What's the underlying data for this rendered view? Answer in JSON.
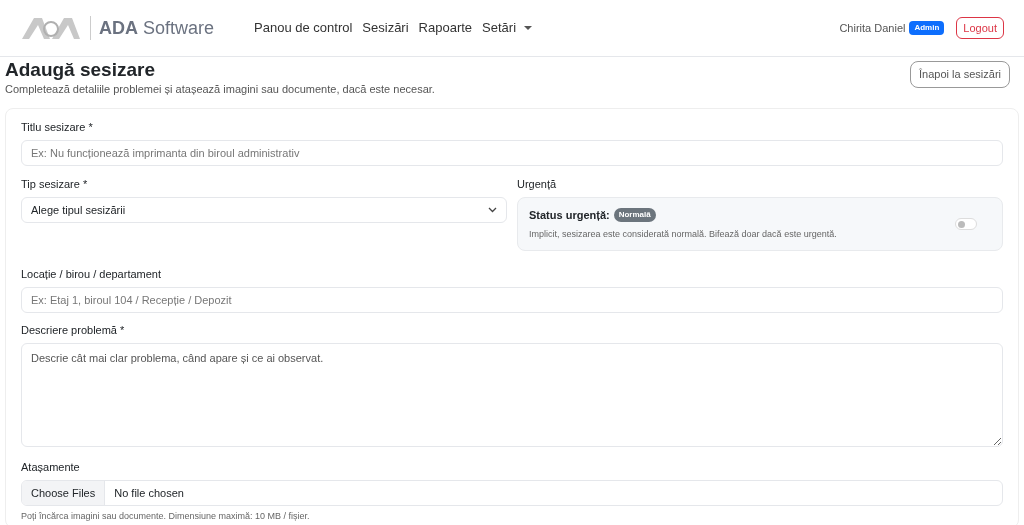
{
  "brand": {
    "name": "ADA",
    "suffix": "Software"
  },
  "nav": [
    {
      "label": "Panou de control",
      "dropdown": false
    },
    {
      "label": "Sesizări",
      "dropdown": false
    },
    {
      "label": "Rapoarte",
      "dropdown": false
    },
    {
      "label": "Setări",
      "dropdown": true
    }
  ],
  "user": {
    "name": "Chirita Daniel",
    "role": "Admin"
  },
  "logout": "Logout",
  "page": {
    "title": "Adaugă sesizare",
    "subtitle": "Completează detaliile problemei și atașează imagini sau documente, dacă este necesar.",
    "back": "Înapoi la sesizări"
  },
  "form": {
    "title_field": {
      "label": "Titlu sesizare *",
      "placeholder": "Ex: Nu funcționează imprimanta din biroul administrativ"
    },
    "type_field": {
      "label": "Tip sesizare *",
      "value": "Alege tipul sesizării"
    },
    "urgency": {
      "label": "Urgență",
      "status_label": "Status urgență:",
      "badge": "Normală",
      "hint": "Implicit, sesizarea este considerată normală. Bifează doar dacă este urgentă.",
      "on": false
    },
    "location_field": {
      "label": "Locație / birou / departament",
      "placeholder": "Ex: Etaj 1, biroul 104 / Recepție / Depozit"
    },
    "description_field": {
      "label": "Descriere problemă *",
      "placeholder": "Descrie cât mai clar problema, când apare și ce ai observat."
    },
    "attachments": {
      "label": "Atașamente",
      "button": "Choose Files",
      "status": "No file chosen",
      "hint": "Poți încărca imagini sau documente. Dimensiune maximă: 10 MB / fișier."
    }
  }
}
